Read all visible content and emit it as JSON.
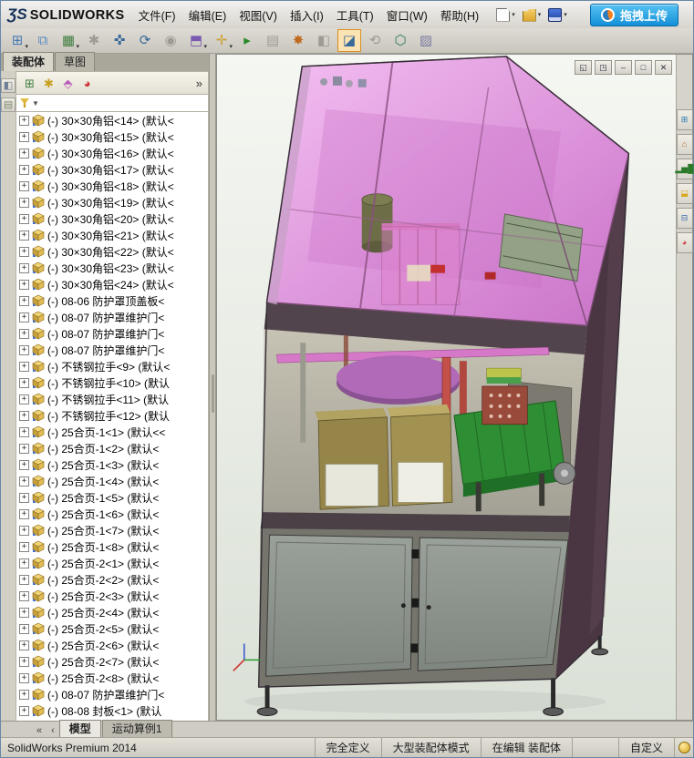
{
  "titlebar": {
    "logo_prefix": "ƷS",
    "logo_text": "SOLIDWORKS",
    "upload_button": "拖拽上传"
  },
  "menubar": [
    "文件(F)",
    "编辑(E)",
    "视图(V)",
    "插入(I)",
    "工具(T)",
    "窗口(W)",
    "帮助(H)"
  ],
  "quickbar": [
    {
      "name": "new-document-icon",
      "caret": true
    },
    {
      "name": "open-document-icon",
      "caret": true
    },
    {
      "name": "save-icon",
      "caret": true
    }
  ],
  "assembly_toolbar": [
    {
      "name": "insert-components-icon",
      "glyph": "⊞",
      "color": "#4a7ab5",
      "caret": true
    },
    {
      "name": "mate-icon",
      "glyph": "⧉",
      "color": "#5a8ac0"
    },
    {
      "name": "linear-component-pattern-icon",
      "glyph": "▦",
      "color": "#3f7d3f",
      "caret": true
    },
    {
      "name": "smart-fasteners-icon",
      "glyph": "✱",
      "color": "#9a9a9a",
      "disabled": true
    },
    {
      "name": "move-component-icon",
      "glyph": "✜",
      "color": "#3a6a9a"
    },
    {
      "name": "rotate-component-icon",
      "glyph": "⟳",
      "color": "#3a6a9a"
    },
    {
      "name": "show-hidden-components-icon",
      "glyph": "◉",
      "color": "#9a9a9a",
      "disabled": true
    },
    {
      "name": "assembly-features-icon",
      "glyph": "⬒",
      "color": "#7a5ab0",
      "caret": true
    },
    {
      "name": "reference-geometry-icon",
      "glyph": "✛",
      "color": "#caa030",
      "caret": true
    },
    {
      "name": "new-motion-study-icon",
      "glyph": "▸",
      "color": "#2a8a2a"
    },
    {
      "name": "bill-of-materials-icon",
      "glyph": "▤",
      "color": "#9a9a9a",
      "disabled": true
    },
    {
      "name": "exploded-view-icon",
      "glyph": "✸",
      "color": "#c06a20"
    },
    {
      "name": "instant3d-icon",
      "glyph": "◧",
      "color": "#9a9a9a",
      "disabled": true
    },
    {
      "name": "section-view-icon",
      "glyph": "◪",
      "color": "#3a6a9a",
      "active": true
    },
    {
      "name": "update-assembly-icon",
      "glyph": "⟲",
      "color": "#9a9a9a",
      "disabled": true
    },
    {
      "name": "simulation-icon",
      "glyph": "⬡",
      "color": "#2a7a5a"
    },
    {
      "name": "curvature-icon",
      "glyph": "▨",
      "color": "#7a7aa0"
    }
  ],
  "doc_controls": [
    {
      "name": "previous-window-icon",
      "glyph": "◱"
    },
    {
      "name": "next-window-icon",
      "glyph": "◳"
    },
    {
      "name": "minimize-button",
      "glyph": "–"
    },
    {
      "name": "restore-button",
      "glyph": "□"
    },
    {
      "name": "close-button",
      "glyph": "✕"
    }
  ],
  "left_strip": [
    {
      "name": "collapse-pane-icon",
      "glyph": "◧",
      "color": "#6f7f95"
    },
    {
      "name": "pin-pane-icon",
      "glyph": "▤",
      "color": "#7f8a6f"
    }
  ],
  "panel": {
    "tabs": [
      {
        "label": "装配体",
        "active": true
      },
      {
        "label": "草图",
        "active": false
      }
    ],
    "fm_toolbar": [
      {
        "name": "featuremanager-tree-icon",
        "glyph": "⊞",
        "color": "#3f7d3f"
      },
      {
        "name": "propertymanager-icon",
        "glyph": "✱",
        "color": "#c8a020"
      },
      {
        "name": "configurationmanager-icon",
        "glyph": "⬘",
        "color": "#b85ab8"
      },
      {
        "name": "displaymanager-icon",
        "glyph": "◕",
        "color": "#cc3333"
      }
    ],
    "fm_overflow": "»",
    "filter_caret": "▼",
    "tree_items": [
      "(-) 30×30角铝<14> (默认<",
      "(-) 30×30角铝<15> (默认<",
      "(-) 30×30角铝<16> (默认<",
      "(-) 30×30角铝<17> (默认<",
      "(-) 30×30角铝<18> (默认<",
      "(-) 30×30角铝<19> (默认<",
      "(-) 30×30角铝<20> (默认<",
      "(-) 30×30角铝<21> (默认<",
      "(-) 30×30角铝<22> (默认<",
      "(-) 30×30角铝<23> (默认<",
      "(-) 30×30角铝<24> (默认<",
      "(-) 08-06 防护罩顶盖板<",
      "(-) 08-07 防护罩维护门<",
      "(-) 08-07 防护罩维护门<",
      "(-) 08-07 防护罩维护门<",
      "(-) 不锈钢拉手<9> (默认<",
      "(-) 不锈钢拉手<10> (默认",
      "(-) 不锈钢拉手<11> (默认",
      "(-) 不锈钢拉手<12> (默认",
      "(-) 25合页-1<1> (默认<<",
      "(-) 25合页-1<2> (默认<",
      "(-) 25合页-1<3> (默认<",
      "(-) 25合页-1<4> (默认<",
      "(-) 25合页-1<5> (默认<",
      "(-) 25合页-1<6> (默认<",
      "(-) 25合页-1<7> (默认<",
      "(-) 25合页-1<8> (默认<",
      "(-) 25合页-2<1> (默认<",
      "(-) 25合页-2<2> (默认<",
      "(-) 25合页-2<3> (默认<",
      "(-) 25合页-2<4> (默认<",
      "(-) 25合页-2<5> (默认<",
      "(-) 25合页-2<6> (默认<",
      "(-) 25合页-2<7> (默认<",
      "(-) 25合页-2<8> (默认<",
      "(-) 08-07 防护罩维护门<",
      "(-) 08-08 封板<1> (默认"
    ],
    "tab_nav": [
      "«",
      "‹"
    ],
    "bottom_tabs": [
      {
        "label": "模型",
        "active": true
      },
      {
        "label": "运动算例1",
        "active": false
      }
    ]
  },
  "viewport": {
    "model_colors": {
      "cover_pink": "#de8ede",
      "frame_dark": "#4a3f48",
      "door_gray": "#90948c",
      "conveyor_green": "#2e8e34",
      "table_purple": "#aa66b2",
      "box_tan": "#958549"
    }
  },
  "taskpane": [
    {
      "name": "solidworks-resources-icon",
      "glyph": "⊞",
      "color": "#2a7ab0"
    },
    {
      "name": "design-library-icon",
      "glyph": "⌂",
      "color": "#b06a28"
    },
    {
      "name": "statistics-icon",
      "glyph": "▂▅█",
      "color": "#2a7a2a"
    },
    {
      "name": "file-explorer-icon",
      "glyph": "⬓",
      "color": "#d8a820"
    },
    {
      "name": "view-palette-icon",
      "glyph": "⊟",
      "color": "#3a6ab0"
    },
    {
      "name": "appearances-icon",
      "glyph": "◕",
      "color": "#cc4444"
    }
  ],
  "statusbar": {
    "left": "SolidWorks Premium 2014",
    "right_icon": "quick-tips-icon",
    "cells": [
      {
        "label": "完全定义",
        "interactable": false
      },
      {
        "label": "大型装配体模式",
        "interactable": false
      },
      {
        "label": "在编辑 装配体",
        "interactable": false
      },
      {
        "label": "",
        "interactable": false
      },
      {
        "label": "自定义",
        "interactable": true
      }
    ]
  }
}
